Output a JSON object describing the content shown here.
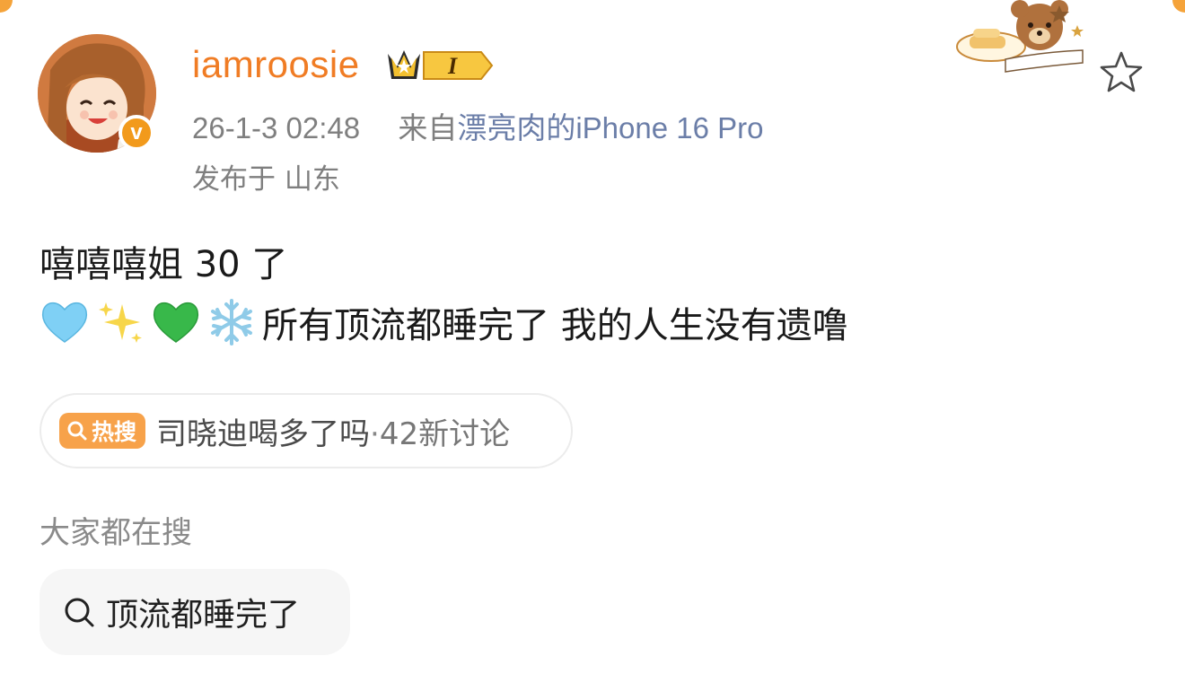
{
  "user": {
    "username": "iamroosie",
    "vip_level": "I",
    "verified_mark": "v"
  },
  "post_meta": {
    "datetime": "26-1-3 02:48",
    "source_prefix": "来自",
    "source": "漂亮肉的iPhone 16 Pro",
    "location": "发布于 山东"
  },
  "post": {
    "line1": "嘻嘻嘻姐 30 了",
    "line2_emojis": [
      "light-blue-heart-icon",
      "sparkles-icon",
      "green-heart-icon",
      "snowflake-icon"
    ],
    "line2_text": "所有顶流都睡完了 我的人生没有遗噜"
  },
  "hot_search": {
    "tag_label": "热搜",
    "topic": "司晓迪喝多了吗",
    "separator": "·",
    "discussion": "42新讨论"
  },
  "related": {
    "title": "大家都在搜",
    "queries": [
      "顶流都睡完了"
    ]
  },
  "colors": {
    "username": "#f07c24",
    "hot_tag": "#f7a24a",
    "meta": "#7f7f7f",
    "accent_corner": "#f5a33a"
  }
}
